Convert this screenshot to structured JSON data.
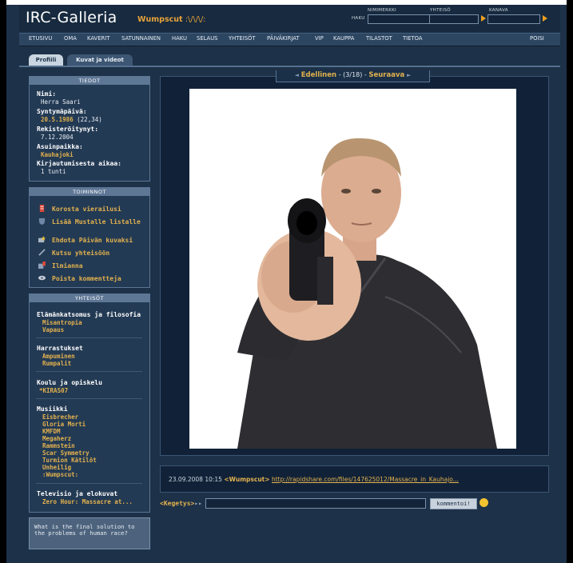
{
  "header": {
    "logo": "IRC-Galleria",
    "username": "Wumpscut",
    "username_deco": ":\\/\\/\\/:",
    "search_label": "HAKU",
    "search_fields": [
      {
        "label": "NIMIMERKKI"
      },
      {
        "label": "YHTEISÖ"
      },
      {
        "label": "KANAVA"
      }
    ]
  },
  "nav": {
    "items": [
      "ETUSIVU",
      "OMA",
      "KAVERIT",
      "SATUNNAINEN",
      "HAKU",
      "SELAUS",
      "YHTEISÖT",
      "PÄIVÄKIRJAT",
      "VIP",
      "KAUPPA",
      "TILASTOT",
      "TIETOA"
    ],
    "logout": "POISI"
  },
  "tabs": [
    "Profiili",
    "Kuvat ja videot"
  ],
  "tiedot": {
    "title": "TIEDOT",
    "name_label": "Nimi:",
    "name": "Herra Saari",
    "birth_label": "Syntymäpäivä:",
    "birth_date": "20.5.1986",
    "age": "(22,34)",
    "registered_label": "Rekisteröitynyt:",
    "registered": "7.12.2004",
    "location_label": "Asuinpaikka:",
    "location": "Kauhajoki",
    "login_label": "Kirjautumisesta aikaa:",
    "login": "1 tunti"
  },
  "toiminnot": {
    "title": "TOIMINNOT",
    "actions": [
      {
        "label": "Korosta vierailusi",
        "icon": "bookmark-icon",
        "color": "#d94a3a"
      },
      {
        "label": "Lisää Mustalle listalle",
        "icon": "shield-icon",
        "color": "#6f86a6"
      },
      {
        "label": "Ehdota Päivän kuvaksi",
        "icon": "star-photo-icon",
        "color": "#e9c23c"
      },
      {
        "label": "Kutsu yhteisöön",
        "icon": "pen-icon",
        "color": "#9aa9bb"
      },
      {
        "label": "Ilmianna",
        "icon": "flag-icon",
        "color": "#d94a3a"
      },
      {
        "label": "Poista kommentteja",
        "icon": "eye-icon",
        "color": "#c9d0da"
      }
    ]
  },
  "yhteisot": {
    "title": "YHTEISÖT",
    "groups": [
      {
        "title": "Elämänkatsomus ja filosofia",
        "items": [
          "Misantropia",
          "Vapaus"
        ]
      },
      {
        "title": "Harrastukset",
        "items": [
          "Ampuminen",
          "Rumpalit"
        ]
      },
      {
        "title": "Koulu ja opiskelu",
        "items": [
          "*KIRAS07"
        ]
      },
      {
        "title": "Musiikki",
        "items": [
          "Eisbrecher",
          "Gloria Morti",
          "KMFDM",
          "Megaherz",
          "Rammstein",
          "Scar Symmetry",
          "Turmion Kätilöt",
          "Unheilig",
          ":Wumpscut:"
        ]
      },
      {
        "title": "Televisio ja elokuvat",
        "items": [
          "Zero Hour: Massacre at..."
        ]
      }
    ]
  },
  "quote": "What is the final solution to the problems of human race?",
  "photo_nav": {
    "prev": "Edellinen",
    "count": "(3/18)",
    "next": "Seuraava"
  },
  "comment": {
    "time": "23.09.2008 10:15",
    "user": "<Wumpscut>",
    "link": "http://rapidshare.com/files/147625012/Massacre_in_Kauhajo..."
  },
  "reply": {
    "label": "<Kegetys>",
    "button": "kommentoi!"
  }
}
